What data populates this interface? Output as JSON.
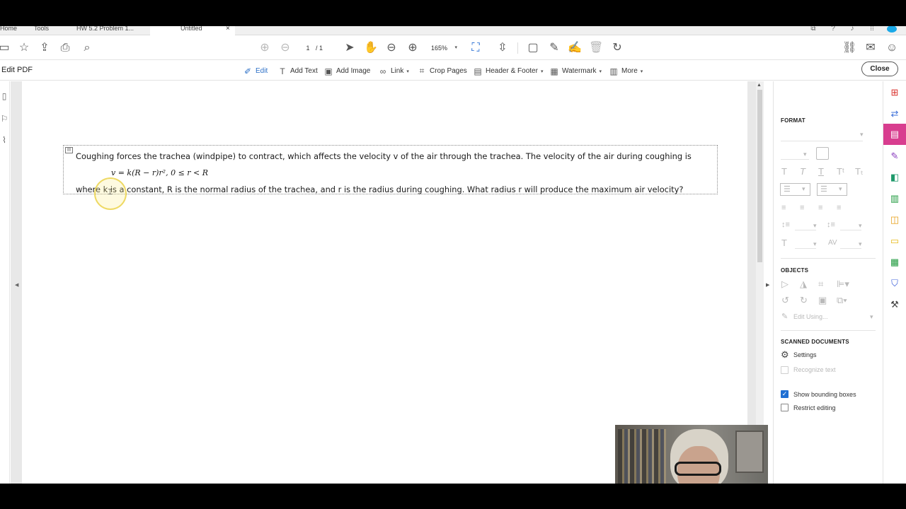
{
  "tabs": [
    {
      "label": "Home"
    },
    {
      "label": "Tools"
    },
    {
      "label": "HW 5.2 Problem 1..."
    },
    {
      "label": "Untitled",
      "close": "×"
    }
  ],
  "toolbar": {
    "page_current": "1",
    "page_total": "/ 1",
    "zoom": "165%",
    "icons": [
      "save-icon",
      "star-icon",
      "upload-icon",
      "print-icon",
      "search-icon",
      "prev-page-icon",
      "next-page-icon",
      "select-icon",
      "hand-icon",
      "zoom-out-icon",
      "zoom-in-icon",
      "fit-icon",
      "scroll-icon",
      "comment-icon",
      "highlight-icon",
      "sign-icon",
      "delete-icon",
      "rotate-icon",
      "link-share-icon",
      "email-icon",
      "user-icon"
    ]
  },
  "editbar": {
    "title": "Edit PDF",
    "items": [
      {
        "label": "Edit",
        "icon": "edit-icon"
      },
      {
        "label": "Add Text",
        "icon": "add-text-icon"
      },
      {
        "label": "Add Image",
        "icon": "add-image-icon"
      },
      {
        "label": "Link",
        "icon": "link-icon"
      },
      {
        "label": "Crop Pages",
        "icon": "crop-icon"
      },
      {
        "label": "Header & Footer",
        "icon": "header-footer-icon"
      },
      {
        "label": "Watermark",
        "icon": "watermark-icon"
      },
      {
        "label": "More",
        "icon": "more-icon"
      }
    ],
    "close_label": "Close"
  },
  "document": {
    "line1": "Coughing forces the trachea (windpipe) to contract, which affects the velocity v of the air through the trachea. The velocity of the air during coughing is",
    "formula": "v = k(R − r)r², 0 ≤ r < R",
    "line3": "where k is a constant, R is the normal radius of the trachea, and r is the radius during coughing. What radius r will produce the maximum air velocity?"
  },
  "format_panel": {
    "format_heading": "FORMAT",
    "objects_heading": "OBJECTS",
    "edit_using": "Edit Using...",
    "scanned_heading": "SCANNED DOCUMENTS",
    "settings_label": "Settings",
    "recognize_label": "Recognize text",
    "show_bounding_label": "Show bounding boxes",
    "show_bounding_checked": true,
    "restrict_label": "Restrict editing",
    "restrict_checked": false
  },
  "colors": {
    "accent": "#2b6fc7",
    "rail_active": "#d83d8f",
    "checkbox": "#1f6fd3"
  }
}
